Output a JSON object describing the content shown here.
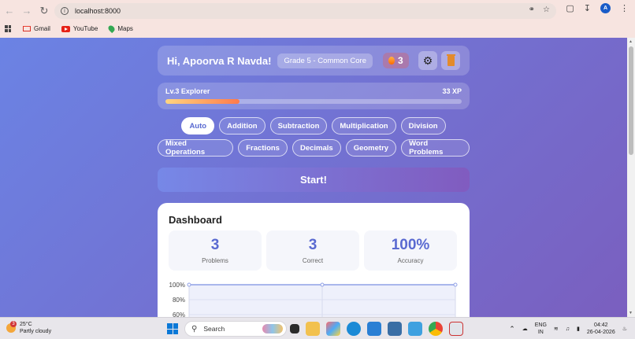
{
  "browser": {
    "url": "localhost:8000",
    "bookmarks": [
      {
        "label": "Gmail",
        "icon": "gmail-icon"
      },
      {
        "label": "YouTube",
        "icon": "youtube-icon"
      },
      {
        "label": "Maps",
        "icon": "maps-icon"
      }
    ],
    "profile_initial": "A"
  },
  "header": {
    "greeting": "Hi, Apoorva R Navda!",
    "grade": "Grade 5 - Common Core",
    "streak": "3"
  },
  "xp": {
    "level": "Lv.3 Explorer",
    "points": "33 XP",
    "progress_fraction": 0.25
  },
  "topics_row1": [
    "Auto",
    "Addition",
    "Subtraction",
    "Multiplication",
    "Division"
  ],
  "topics_row2": [
    "Mixed Operations",
    "Fractions",
    "Decimals",
    "Geometry",
    "Word Problems"
  ],
  "active_topic": "Auto",
  "start_label": "Start!",
  "dashboard": {
    "title": "Dashboard",
    "stats": [
      {
        "value": "3",
        "label": "Problems"
      },
      {
        "value": "3",
        "label": "Correct"
      },
      {
        "value": "100%",
        "label": "Accuracy"
      }
    ]
  },
  "chart_data": {
    "type": "line",
    "title": "",
    "xlabel": "",
    "ylabel": "",
    "y_tick_labels": [
      "100%",
      "80%",
      "60%"
    ],
    "ylim": [
      60,
      100
    ],
    "x": [
      1,
      2,
      3
    ],
    "series": [
      {
        "values": [
          100,
          100,
          100
        ]
      }
    ],
    "grid": true,
    "line_color": "#8fa0e6"
  },
  "taskbar": {
    "weather_temp": "25°C",
    "weather_desc": "Partly cloudy",
    "weather_alert": "3",
    "search_placeholder": "Search",
    "lang_top": "ENG",
    "lang_bottom": "IN",
    "time": "04:42",
    "date": "26-04-2026"
  },
  "colors": {
    "accent": "#5a6ad1",
    "page_gradient_start": "#6b83e4",
    "page_gradient_end": "#7a5fbf"
  }
}
